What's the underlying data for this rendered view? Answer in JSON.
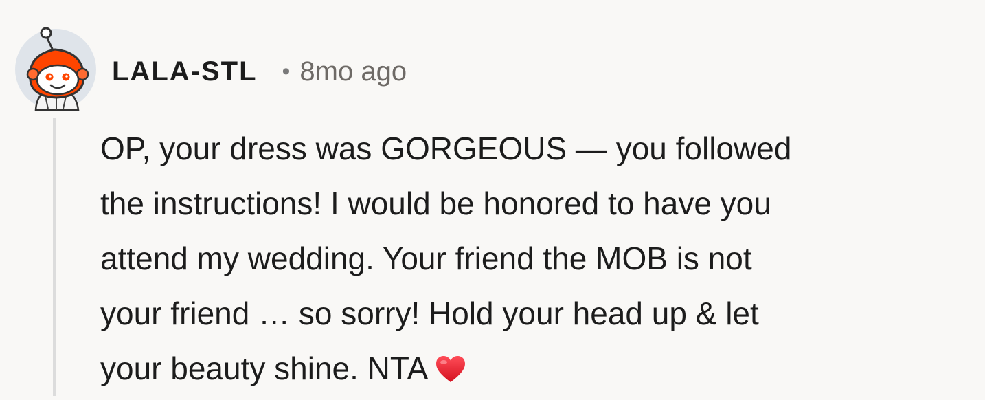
{
  "comment": {
    "avatar_icon": "snoo-avatar-icon",
    "username": "LALA-STL",
    "separator": "•",
    "timestamp": "8mo ago",
    "body_lines": [
      "OP, your dress was GORGEOUS — you followed",
      "the instructions! I would be honored to have you",
      "attend my wedding. Your friend the MOB is not",
      "your friend … so sorry! Hold your head up & let",
      "your beauty shine. NTA"
    ],
    "emoji_icon": "red-heart-icon",
    "colors": {
      "background": "#f9f8f6",
      "text": "#1c1c1c",
      "muted": "#6e6a66",
      "avatar_accent": "#ff4500",
      "heart": "#e0212f"
    }
  }
}
